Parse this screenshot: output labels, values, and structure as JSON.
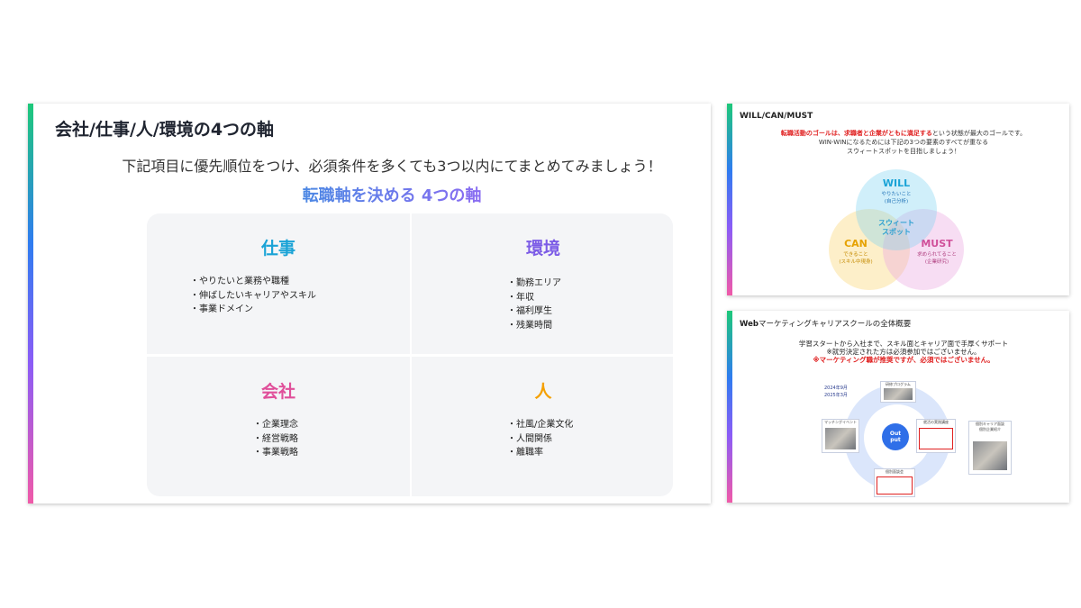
{
  "main": {
    "title": "会社/仕事/人/環境の4つの軸",
    "instruction": "下記項目に優先順位をつけ、必須条件を多くても3つ以内にてまとめてみましょう！",
    "heading": "転職軸を決める 4つの軸",
    "quadrants": [
      {
        "title": "仕事",
        "items": [
          "やりたいと業務や職種",
          "伸ばしたいキャリアやスキル",
          "事業ドメイン"
        ]
      },
      {
        "title": "環境",
        "items": [
          "勤務エリア",
          "年収",
          "福利厚生",
          "残業時間"
        ]
      },
      {
        "title": "会社",
        "items": [
          "企業理念",
          "経営戦略",
          "事業戦略"
        ]
      },
      {
        "title": "人",
        "items": [
          "社風/企業文化",
          "人間関係",
          "離職率"
        ]
      }
    ]
  },
  "wcm": {
    "title": "WILL/CAN/MUST",
    "intro_red": "転職活動のゴールは、求職者と企業がともに満足する",
    "intro_rest": "という状態が最大のゴールです。",
    "intro_line2": "WIN-WINになるためには下記の3つの要素のすべてが重なる",
    "intro_line3": "スウィートスポットを目指しましょう！",
    "will": {
      "label": "WILL",
      "sub1": "やりたいこと",
      "sub2": "(自己分析)"
    },
    "can": {
      "label": "CAN",
      "sub1": "できること",
      "sub2": "(スキル中現身)"
    },
    "must": {
      "label": "MUST",
      "sub1": "求められてること",
      "sub2": "(企業研究)"
    },
    "sweet1": "スウィート",
    "sweet2": "スポット"
  },
  "web": {
    "title_bold": "Web",
    "title_rest": "マーケティングキャリアスクールの全体概要",
    "line1": "学習スタートから入社まで、スキル面とキャリア面で手厚くサポート",
    "line2": "※就労決定された方は必須参加ではございません。",
    "line3": "※マーケティング職が推奨ですが、必須ではございません。",
    "date1": "2024年9月",
    "date2": "2025年3月",
    "core1": "Out",
    "core2": "put",
    "card_top": "研修プログラム",
    "card_left": "マッチングイベント",
    "card_right": "就活の実践講座",
    "card_bottom": "個別面談会",
    "card_far1": "個別キャリア面談",
    "card_far2": "個別企業紹介"
  },
  "colors": {
    "accent_start": "#1ec97a",
    "accent_mid": "#2f7cf0",
    "accent_end": "#f05aa8"
  }
}
